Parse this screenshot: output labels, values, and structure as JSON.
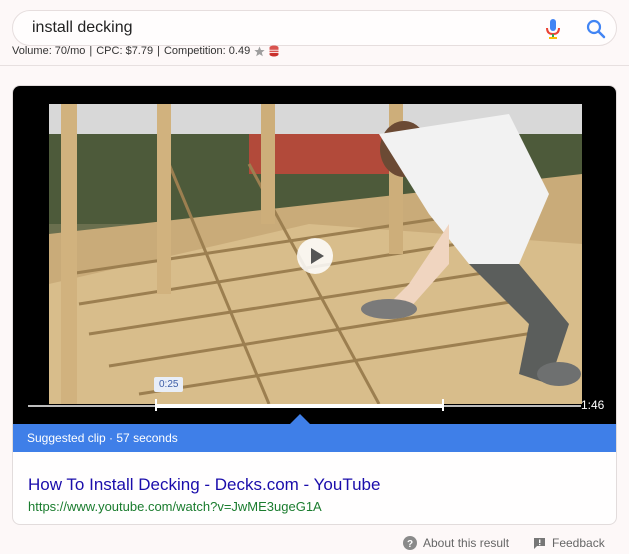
{
  "search": {
    "query": "install decking"
  },
  "seo_bar": {
    "volume": "Volume: 70/mo",
    "cpc": "CPC: $7.79",
    "competition": "Competition: 0.49",
    "separator": "|"
  },
  "video": {
    "clip_start_label": "0:25",
    "duration": "1:46",
    "suggested": "Suggested clip · 57 seconds"
  },
  "result": {
    "title": "How To Install Decking - Decks.com - YouTube",
    "url": "https://www.youtube.com/watch?v=JwME3ugeG1A"
  },
  "footer": {
    "about": "About this result",
    "feedback": "Feedback"
  },
  "colors": {
    "accent": "#3f7fe8",
    "link": "#1a0dab",
    "url": "#1a7c2e"
  },
  "icons": [
    "mic-icon",
    "search-icon",
    "star-icon",
    "db-icon",
    "play-icon",
    "help-icon",
    "feedback-icon"
  ]
}
